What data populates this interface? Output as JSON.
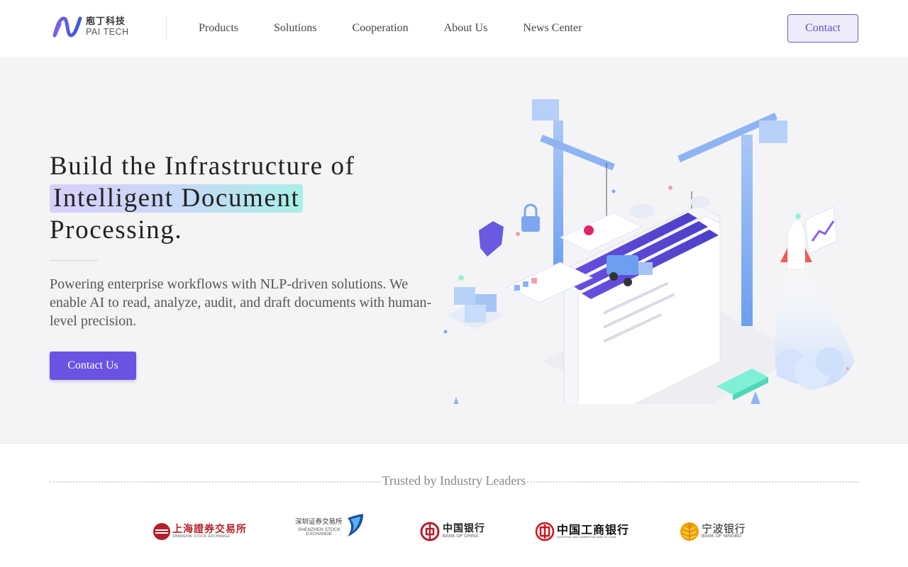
{
  "brand": {
    "name_cn": "庖丁科技",
    "name_en": "PAI TECH",
    "accent": "#6c52e2"
  },
  "nav": {
    "items": [
      {
        "label": "Products"
      },
      {
        "label": "Solutions"
      },
      {
        "label": "Cooperation"
      },
      {
        "label": "About Us"
      },
      {
        "label": "News Center"
      }
    ],
    "contact_label": "Contact"
  },
  "hero": {
    "title_line1": "Build the Infrastructure of",
    "title_highlight": "Intelligent Document",
    "title_line3": "Processing.",
    "description": "Powering enterprise workflows with NLP-driven solutions. We enable AI to read, analyze, audit, and draft documents with human-level precision.",
    "cta_label": "Contact Us",
    "illustration_icon": "document-construction-illustration"
  },
  "trusted": {
    "title": "Trusted by Industry Leaders",
    "partners": [
      {
        "name_cn": "上海證券交易所",
        "name_en": "SHANGHAI STOCK EXCHANGE",
        "color": "#b3202a"
      },
      {
        "name_cn": "深圳证券交易所",
        "name_en": "SHENZHEN STOCK EXCHANGE",
        "color": "#1a4fa0"
      },
      {
        "name_cn": "中国银行",
        "name_en": "BANK OF CHINA",
        "color": "#b3202a"
      },
      {
        "name_cn": "中国工商银行",
        "name_en": "INDUSTRIAL AND COMMERCIAL BANK OF CHINA",
        "color": "#c8161d"
      },
      {
        "name_cn": "宁波银行",
        "name_en": "BANK OF NINGBO",
        "color": "#f0a000"
      }
    ]
  }
}
